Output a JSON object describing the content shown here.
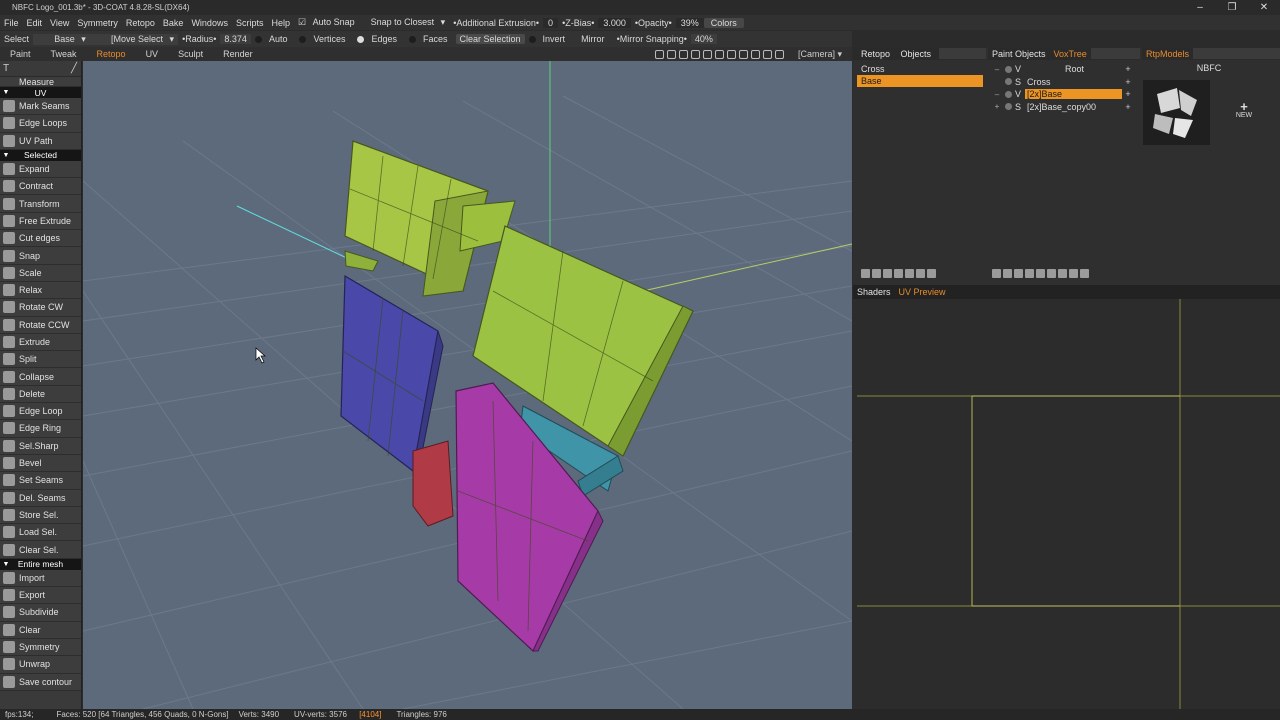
{
  "window": {
    "title": "NBFC Logo_001.3b* - 3D-COAT 4.8.28-SL(DX64)",
    "minimize": "–",
    "restore": "❐",
    "close": "✕"
  },
  "menu": [
    "File",
    "Edit",
    "View",
    "Symmetry",
    "Retopo",
    "Bake",
    "Windows",
    "Scripts",
    "Help"
  ],
  "menu_controls": {
    "auto_snap": "Auto Snap",
    "snap_mode": "Snap to Closest",
    "additional_extrusion_label": "•Additional Extrusion•",
    "additional_extrusion_value": "0",
    "zbias_label": "•Z-Bias•",
    "zbias_value": "3.000",
    "opacity_label": "•Opacity•",
    "opacity_value": "39%",
    "colors_button": "Colors"
  },
  "toolbar": {
    "select": "Select",
    "base": "Base",
    "move_select": "[Move Select",
    "radius_label": "•Radius•",
    "radius_value": "8.374",
    "auto": "Auto",
    "vertices": "Vertices",
    "edges": "Edges",
    "faces": "Faces",
    "clear_selection": "Clear Selection",
    "invert": "Invert",
    "mirror": "Mirror",
    "mirror_snapping_label": "•Mirror Snapping•",
    "mirror_snapping_value": "40%"
  },
  "room_tabs": [
    "Paint",
    "Tweak",
    "Retopo",
    "UV",
    "Sculpt",
    "Render"
  ],
  "active_room": "Retopo",
  "camera_label": "[Camera]",
  "left_panel": {
    "top_icons": "T",
    "measure": "Measure",
    "uv_header": "UV",
    "uv_items": [
      "Mark Seams",
      "Edge Loops",
      "UV Path"
    ],
    "selected_header": "Selected",
    "selected_items": [
      "Expand",
      "Contract",
      "Transform",
      "Free Extrude",
      "Cut edges",
      "Snap",
      "Scale",
      "Relax",
      "Rotate CW",
      "Rotate CCW",
      "Extrude",
      "Split",
      "Collapse",
      "Delete",
      "Edge Loop",
      "Edge Ring",
      "Sel.Sharp",
      "Bevel",
      "Set Seams",
      "Del. Seams",
      "Store Sel.",
      "Load Sel.",
      "Clear Sel."
    ],
    "entire_header": "Entire mesh",
    "entire_items": [
      "Import",
      "Export",
      "Subdivide",
      "Clear",
      "Symmetry",
      "Unwrap",
      "Save contour"
    ]
  },
  "retopo_objects": {
    "header_retopo": "Retopo",
    "header_objects": "Objects",
    "items": [
      "Cross",
      "Base"
    ],
    "selected": "Base"
  },
  "vox_tree": {
    "header_paint": "Paint Objects",
    "header_vox": "VoxTree",
    "rows": [
      {
        "type": "V",
        "name": "Root"
      },
      {
        "type": "S",
        "name": "Cross"
      },
      {
        "type": "V",
        "name": "[2x]Base"
      },
      {
        "type": "S",
        "name": "[2x]Base_copy00"
      }
    ],
    "selected": "[2x]Base"
  },
  "rtp_models": {
    "header": "RtpModels",
    "model": "NBFC",
    "new_label": "NEW",
    "new_plus": "+"
  },
  "uv_panel": {
    "tab_shaders": "Shaders",
    "tab_uvpreview": "UV Preview"
  },
  "status": {
    "fps": "fps:134;",
    "faces": "Faces: 520 [64 Triangles, 456 Quads, 0 N-Gons]",
    "verts": "Verts: 3490",
    "uv_verts_label": "UV-verts: 3576",
    "uv_verts_highlight": "[4104]",
    "triangles": "Triangles: 976"
  },
  "colors": {
    "accent": "#e98c2b",
    "viewport_bg": "#5d6a7c",
    "green": "#9cbf3e",
    "blue": "#4b49a6",
    "magenta": "#a63ba8",
    "teal": "#3f93a6",
    "red": "#b23b47"
  }
}
